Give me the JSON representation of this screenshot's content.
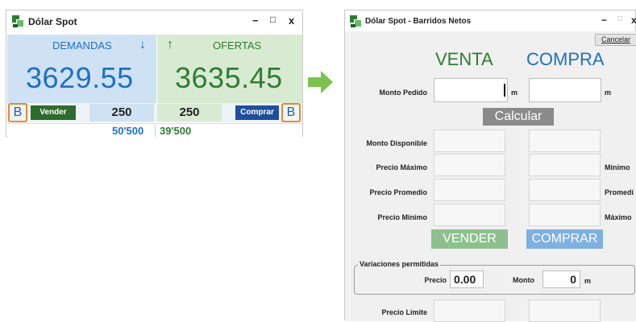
{
  "left_window": {
    "title": "Dólar Spot",
    "controls": {
      "minimize": "−",
      "maximize": "□",
      "close": "x"
    },
    "demandas": {
      "label": "DEMANDAS",
      "price": "3629.55",
      "arrow": "↓",
      "color": "#1f6fc5"
    },
    "ofertas": {
      "label": "OFERTAS",
      "price": "3635.45",
      "arrow": "↑",
      "color": "#2e7d32"
    },
    "b_left": "B",
    "b_right": "B",
    "vender_label": "Vender",
    "comprar_label": "Comprar",
    "qty_demanda": "250",
    "qty_oferta": "250",
    "vol_demanda": "50'500",
    "vol_oferta": "39'500"
  },
  "right_window": {
    "title": "Dólar Spot - Barridos Netos",
    "controls": {
      "minimize": "−",
      "maximize": "□",
      "close": "x"
    },
    "cancelar_label": "Cancelar",
    "venta_label": "VENTA",
    "compra_label": "COMPRA",
    "monto_pedido_label": "Monto Pedido",
    "unit_m": "m",
    "calcular_label": "Calcular",
    "monto_disponible_label": "Monto Disponible",
    "precio_maximo_label": "Precio Máximo",
    "precio_promedio_label": "Precio Promedio",
    "precio_minimo_label": "Precio Mínimo",
    "right_minimo_label": "Mínimo",
    "right_promedio_label": "Promedi",
    "right_maximo_label": "Máximo",
    "vender_label": "VENDER",
    "comprar_label": "COMPRAR",
    "variaciones_label": "Variaciones permitidas",
    "precio_label": "Precio",
    "precio_value": "0.00",
    "monto_label": "Monto",
    "monto_value": "0",
    "precio_limite_label": "Precio Limite",
    "colors": {
      "venta": "#2e7d32",
      "compra": "#1f6fc5",
      "vender_btn": "#8fbf8f",
      "comprar_btn": "#7fb0e0"
    }
  },
  "arrow_icon": "right-arrow-icon"
}
